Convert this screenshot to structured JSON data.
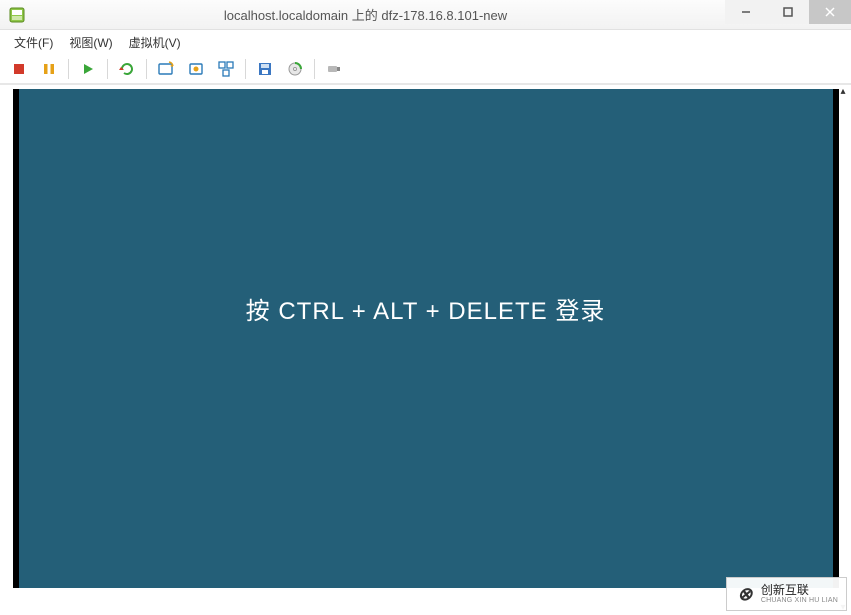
{
  "window": {
    "title": "localhost.localdomain 上的 dfz-178.16.8.101-new"
  },
  "menu": {
    "file": "文件(F)",
    "view": "视图(W)",
    "vm": "虚拟机(V)"
  },
  "guest": {
    "login_prompt": "按 CTRL + ALT + DELETE 登录"
  },
  "watermark": {
    "brand_cn": "创新互联",
    "brand_en": "CHUANG XIN HU LIAN"
  },
  "colors": {
    "guest_bg": "#245f78"
  },
  "toolbar_buttons": [
    "power-off",
    "pause",
    "play",
    "refresh-cycle",
    "refresh-clock",
    "snapshot-revert",
    "snapshot-manager",
    "floppy",
    "cd-dvd",
    "send-cad"
  ]
}
